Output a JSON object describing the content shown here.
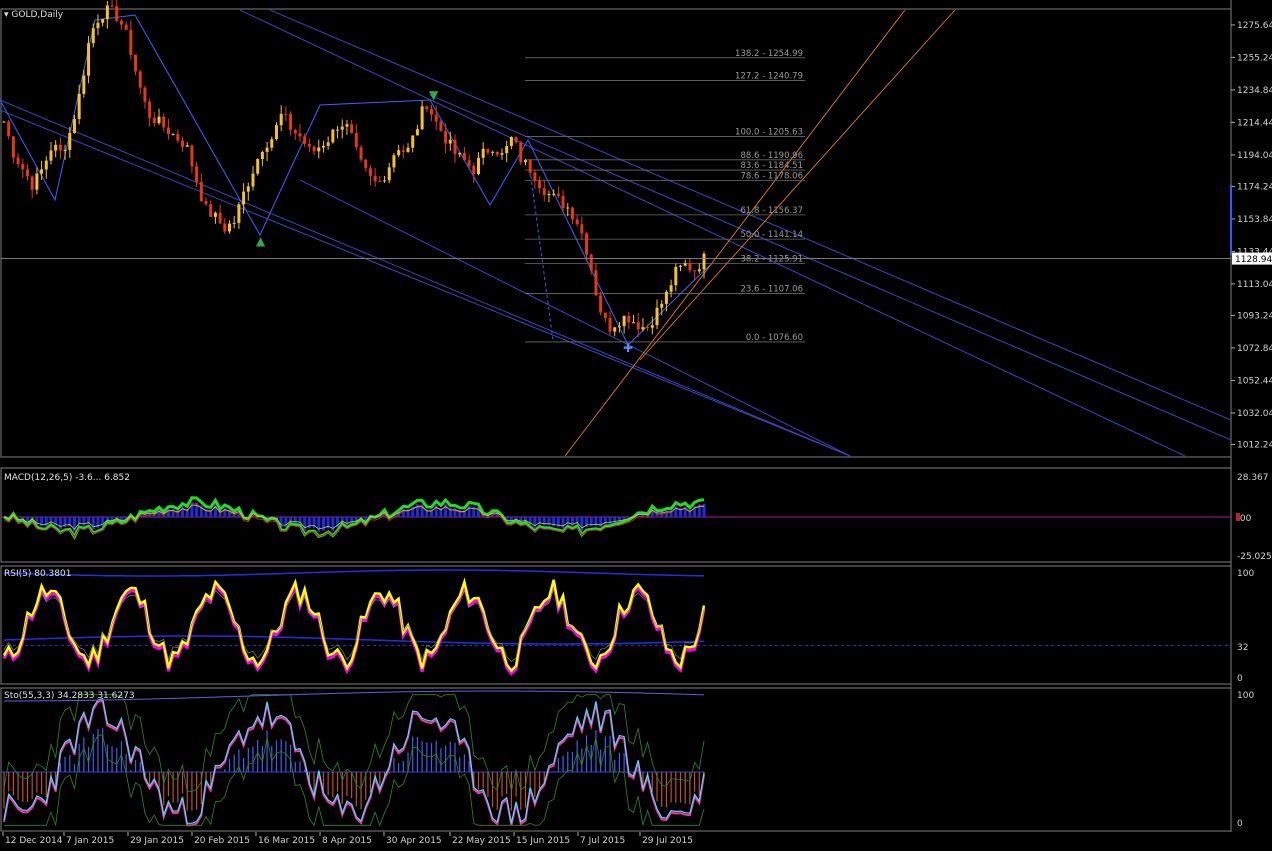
{
  "window": {
    "symbol_title": "GOLD,Daily"
  },
  "colors": {
    "background": "#000000",
    "bull_candle": "#f2c230",
    "bear_candle": "#e0391c",
    "channel_blue": "#3b4fd6",
    "channel_orange": "#e07d1e",
    "fib_grey": "#6b6b6b",
    "macd_line": "#22dd22",
    "macd_hist": "#1a2fd9",
    "rsi_line": "#ffff00",
    "rsi_shadow": "#ff00ff",
    "sto_main": "#ff2fa0",
    "sto_signal": "#40e0ff",
    "price_tag_bg": "#ffffff"
  },
  "price_axis": {
    "ticks": [
      "1275.64",
      "1255.24",
      "1234.84",
      "1214.44",
      "1194.04",
      "1174.24",
      "1153.84",
      "1133.44",
      "1113.04",
      "1093.24",
      "1072.84",
      "1052.44",
      "1032.04",
      "1012.24"
    ],
    "current_price": "1128.94"
  },
  "date_axis": [
    "12 Dec 2014",
    "7 Jan 2015",
    "29 Jan 2015",
    "20 Feb 2015",
    "16 Mar 2015",
    "8 Apr 2015",
    "30 Apr 2015",
    "22 May 2015",
    "15 Jun 2015",
    "7 Jul 2015",
    "29 Jul 2015"
  ],
  "fibonacci": [
    {
      "label": "138.2 - 1254.99"
    },
    {
      "label": "127.2 - 1240.79"
    },
    {
      "label": "100.0 - 1205.63"
    },
    {
      "label": "88.6 - 1190.96"
    },
    {
      "label": "83.6 - 1184.51"
    },
    {
      "label": "78.6 - 1178.06"
    },
    {
      "label": "61.8 - 1156.37"
    },
    {
      "label": "50.0 - 1141.14"
    },
    {
      "label": "38.2 - 1125.91"
    },
    {
      "label": "23.6 - 1107.06"
    },
    {
      "label": "0.0 - 1076.60"
    }
  ],
  "macd": {
    "label": "MACD(12,26,5) -3.6... 6.852",
    "scale_top": "28.367",
    "scale_zero": ".00",
    "scale_bottom": "-25.025"
  },
  "rsi": {
    "label": "RSI(5) 80.3801",
    "scale_top": "100",
    "scale_mid": "32",
    "scale_bottom": "0"
  },
  "stochastic": {
    "label": "Sto(55,3,3) 34.2833 31.6273",
    "scale_top": "100",
    "scale_bottom": "0"
  },
  "chart_data": {
    "type": "candlestick",
    "title": "GOLD,Daily",
    "y_range": [
      1000,
      1290
    ],
    "x": [
      "12 Dec 2014",
      "7 Jan 2015",
      "29 Jan 2015",
      "20 Feb 2015",
      "16 Mar 2015",
      "8 Apr 2015",
      "30 Apr 2015",
      "22 May 2015",
      "15 Jun 2015",
      "7 Jul 2015",
      "29 Jul 2015"
    ],
    "close_path": [
      1215,
      1195,
      1185,
      1175,
      1185,
      1200,
      1195,
      1210,
      1235,
      1270,
      1282,
      1285,
      1280,
      1265,
      1240,
      1220,
      1215,
      1210,
      1205,
      1200,
      1180,
      1160,
      1155,
      1148,
      1152,
      1170,
      1185,
      1200,
      1205,
      1220,
      1210,
      1205,
      1195,
      1200,
      1205,
      1215,
      1210,
      1190,
      1180,
      1175,
      1185,
      1200,
      1195,
      1210,
      1228,
      1215,
      1205,
      1195,
      1190,
      1185,
      1195,
      1200,
      1193,
      1205,
      1190,
      1185,
      1175,
      1168,
      1165,
      1160,
      1150,
      1130,
      1100,
      1085,
      1090,
      1093,
      1088,
      1085,
      1095,
      1105,
      1120,
      1125,
      1122,
      1128.94
    ],
    "current_price": 1128.94
  }
}
